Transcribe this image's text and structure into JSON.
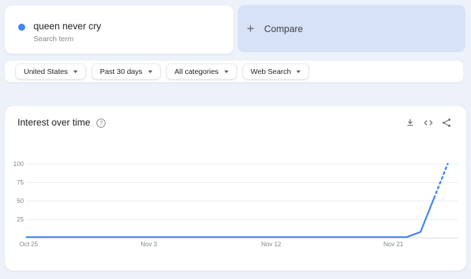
{
  "colors": {
    "accent_blue": "#4285f4",
    "compare_card_bg": "#d7e2f7",
    "page_bg": "#edf1f9"
  },
  "term_card": {
    "title": "queen never cry",
    "subtitle": "Search term"
  },
  "compare_card": {
    "plus_icon": "+",
    "label": "Compare"
  },
  "filters": [
    "United States",
    "Past 30 days",
    "All categories",
    "Web Search"
  ],
  "chart_header": {
    "title": "Interest over time",
    "help_icon": "?"
  },
  "chart_data": {
    "type": "line",
    "title": "Interest over time",
    "xlabel": "",
    "ylabel": "",
    "x_range": [
      "Oct 25",
      "Nov 25"
    ],
    "xticks": [
      "Oct 25",
      "Nov 3",
      "Nov 12",
      "Nov 21"
    ],
    "xtick_day_indices": [
      0,
      9,
      18,
      27
    ],
    "yticks": [
      100,
      75,
      50,
      25
    ],
    "ylim": [
      0,
      100
    ],
    "grid": true,
    "legend_position": "none",
    "series": [
      {
        "name": "queen never cry",
        "color": "#4285f4",
        "cadence": "daily",
        "values": [
          1,
          1,
          1,
          1,
          1,
          1,
          1,
          1,
          1,
          1,
          1,
          1,
          1,
          1,
          1,
          1,
          1,
          1,
          1,
          1,
          1,
          1,
          1,
          1,
          1,
          1,
          1,
          1,
          1,
          8,
          54,
          100
        ],
        "dotted_from_index": 30,
        "dotted_meaning": "partial data"
      }
    ]
  }
}
